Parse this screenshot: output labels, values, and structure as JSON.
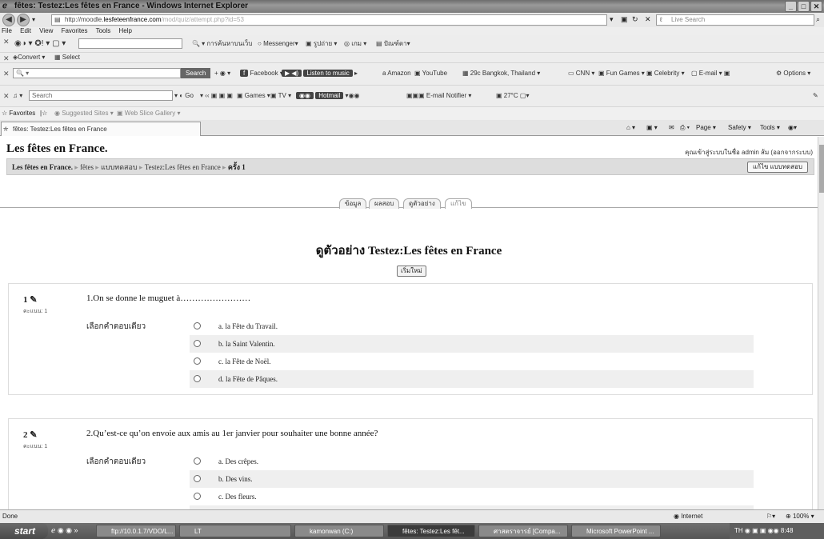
{
  "window": {
    "title": "fêtes: Testez:Les fêtes en France - Windows Internet Explorer",
    "address_prefix": "http://moodle.",
    "address_domain": "lesfeteenfrance.com",
    "address_rest": "/mod/quiz/attempt.php?id=53",
    "search_placeholder": "Live Search"
  },
  "menu": [
    "File",
    "Edit",
    "View",
    "Favorites",
    "Tools",
    "Help"
  ],
  "toolbars": {
    "row1": {
      "search_text": "การค้นหาบนเว็บ",
      "messenger": "Messenger",
      "thai1": "รูปถ่าย",
      "games": "เกม",
      "thai2": "ปัณฑ์ตา"
    },
    "row2": {
      "convert": "Convert",
      "select": "Select"
    },
    "row3": {
      "search_btn": "Search",
      "facebook": "Facebook",
      "listen": "Listen to music",
      "amazon": "Amazon",
      "youtube": "YouTube",
      "weather": "29c Bangkok, Thailand",
      "cnn": "CNN",
      "fungames": "Fun Games",
      "celebrity": "Celebrity",
      "email": "E-mail",
      "options": "Options"
    },
    "row4": {
      "search_placeholder": "Search",
      "go": "Go",
      "games": "Games",
      "tv": "TV",
      "hotmail": "Hotmail",
      "email_notifier": "E-mail Notifier",
      "temp": "27°C"
    }
  },
  "favorites": {
    "label": "Favorites",
    "suggested": "Suggested Sites",
    "webslice": "Web Slice Gallery"
  },
  "tab": {
    "title": "fêtes: Testez:Les fêtes en France",
    "page": "Page",
    "safety": "Safety",
    "tools": "Tools"
  },
  "page": {
    "site_title": "Les fêtes en France.",
    "login_info": "คุณเข้าสู่ระบบในชื่อ admin ส้ม (ออกจากระบบ)",
    "breadcrumb": [
      "Les fêtes en France.",
      "fêtes",
      "แบบทดสอบ",
      "Testez:Les fêtes en France",
      "ครั้ง 1"
    ],
    "edit_quiz_btn": "แก้ไข แบบทดสอบ",
    "tabs": [
      "ข้อมูล",
      "ผลสอบ",
      "ดูตัวอย่าง",
      "แก้ไข"
    ],
    "heading": "ดูตัวอย่าง Testez:Les fêtes en France",
    "start_again": "เริ่มใหม่",
    "prompt_label": "เลือกคำตอบเดียว",
    "marks_label": "คะแนน: 1",
    "questions": [
      {
        "number": "1",
        "text": "1.On se donne le muguet à……………………",
        "options": [
          "a. la Fête du Travail.",
          "b. la Saint Valentin.",
          "c. la Fête de Noël.",
          "d. la Fête de Pâques."
        ]
      },
      {
        "number": "2",
        "text": "2.Qu’est-ce qu’on envoie aux amis au 1er janvier pour souhaiter une bonne année?",
        "options": [
          "a. Des crêpes.",
          "b. Des vins.",
          "c. Des fleurs."
        ]
      }
    ]
  },
  "status": {
    "left": "Done",
    "zone": "Internet",
    "zoom": "100%"
  },
  "taskbar": {
    "start": "start",
    "tasks": [
      "ftp://10.0.1.7/VDO/L...",
      "LT",
      "kamonwan (C:)",
      "fêtes: Testez:Les fêt...",
      "ศาสตราจารย์ [Compa...",
      "Microsoft PowerPoint ..."
    ],
    "tray_lang": "TH",
    "clock": "8:48"
  }
}
